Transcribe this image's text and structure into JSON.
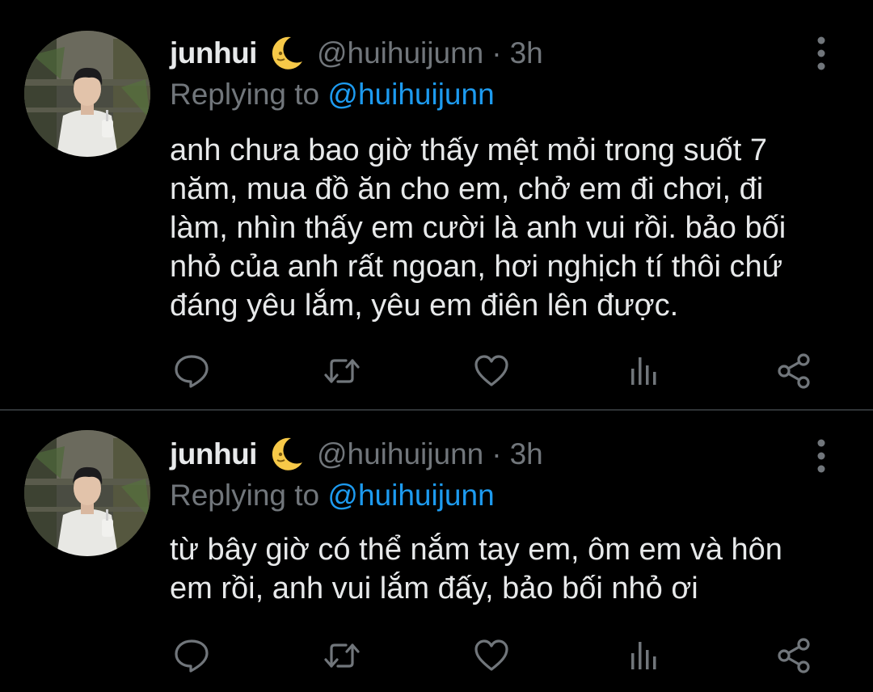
{
  "colors": {
    "background": "#000000",
    "text": "#e7e9ea",
    "secondary": "#71767b",
    "accent": "#1d9bf0",
    "divider": "#2f3336"
  },
  "tweets": [
    {
      "author": {
        "name": "junhui",
        "emoji": "crescent-moon-face-emoji",
        "handle": "@huihuijunn"
      },
      "separator": "·",
      "time": "3h",
      "replying_prefix": "Replying to",
      "replying_to": "@huihuijunn",
      "body_lines": [
        "anh chưa bao giờ thấy mệt mỏi trong suốt 7",
        "năm, mua đồ ăn cho em, chở em đi chơi, đi",
        "làm, nhìn thấy em cười là anh vui rồi. bảo bối",
        "nhỏ của anh rất ngoan, hơi nghịch tí thôi chứ",
        "đáng yêu lắm, yêu em điên lên được."
      ],
      "actions": [
        "reply-icon",
        "retweet-icon",
        "like-icon",
        "analytics-icon",
        "share-icon"
      ]
    },
    {
      "author": {
        "name": "junhui",
        "emoji": "crescent-moon-face-emoji",
        "handle": "@huihuijunn"
      },
      "separator": "·",
      "time": "3h",
      "replying_prefix": "Replying to",
      "replying_to": "@huihuijunn",
      "body_lines": [
        "từ bây giờ có thể nắm tay em, ôm em và hôn",
        "em rồi, anh vui lắm đấy, bảo bối nhỏ ơi"
      ],
      "actions": [
        "reply-icon",
        "retweet-icon",
        "like-icon",
        "analytics-icon",
        "share-icon"
      ]
    }
  ]
}
